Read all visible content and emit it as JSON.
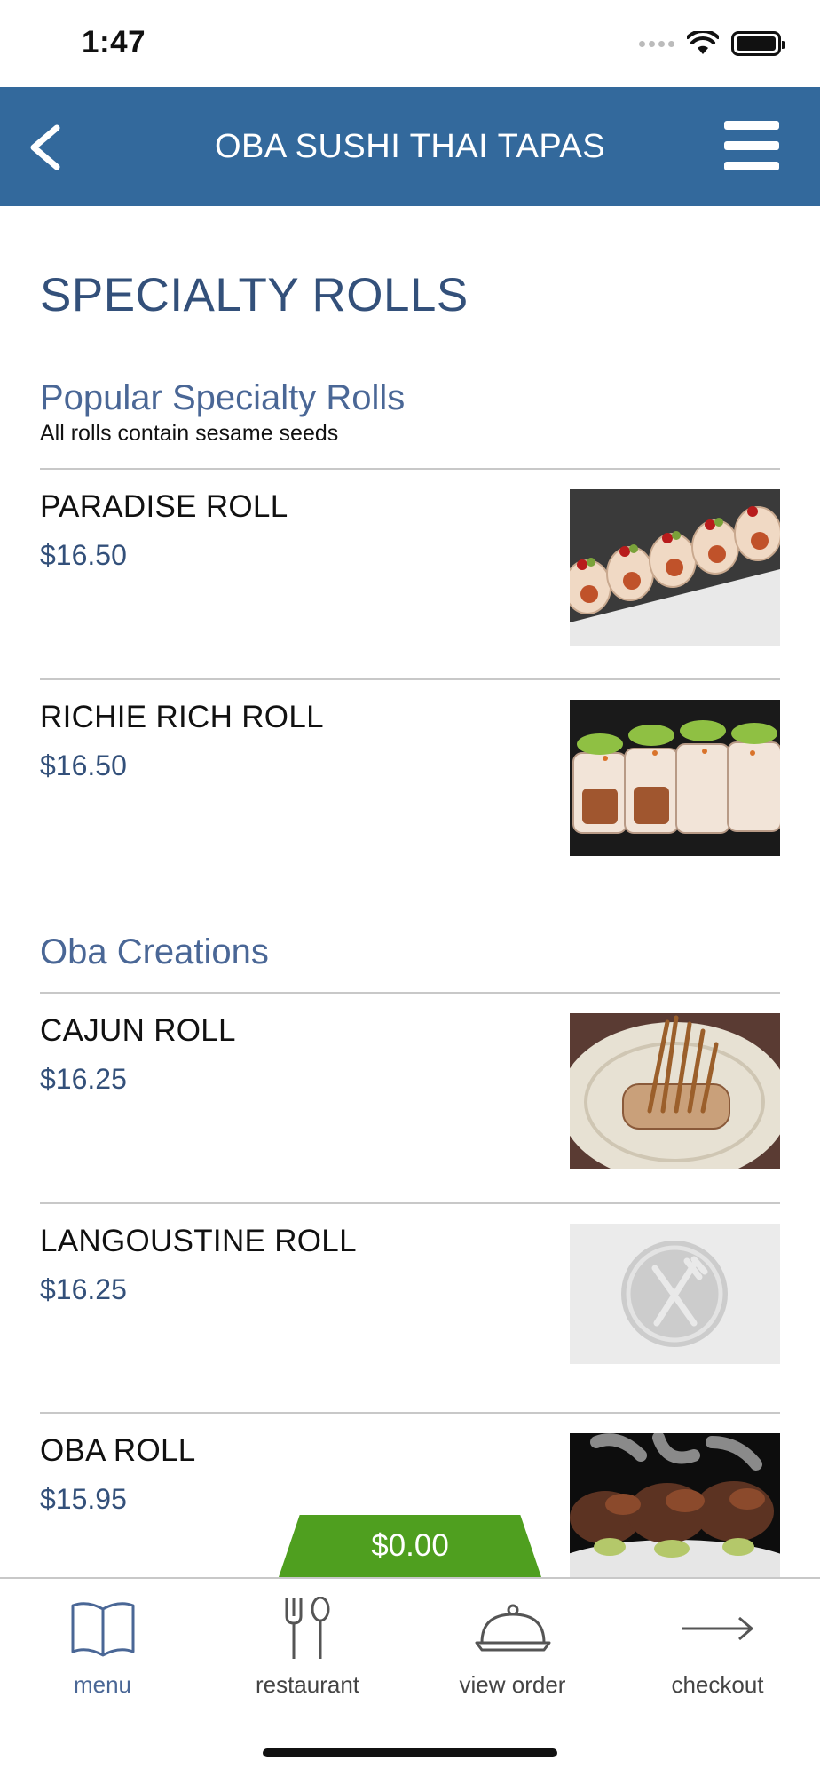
{
  "status_bar": {
    "time": "1:47"
  },
  "header": {
    "title": "OBA SUSHI THAI TAPAS"
  },
  "section": {
    "title": "SPECIALTY ROLLS"
  },
  "groups": [
    {
      "title": "Popular Specialty Rolls",
      "note": "All rolls contain sesame seeds",
      "items": [
        {
          "name": "PARADISE ROLL",
          "price": "$16.50"
        },
        {
          "name": "RICHIE RICH ROLL",
          "price": "$16.50"
        }
      ]
    },
    {
      "title": "Oba Creations",
      "items": [
        {
          "name": "CAJUN ROLL",
          "price": "$16.25"
        },
        {
          "name": "LANGOUSTINE ROLL",
          "price": "$16.25"
        },
        {
          "name": "OBA ROLL",
          "price": "$15.95"
        }
      ]
    }
  ],
  "cart": {
    "total": "$0.00"
  },
  "bottom_nav": {
    "items": [
      {
        "label": "menu",
        "icon": "book-icon",
        "active": true
      },
      {
        "label": "restaurant",
        "icon": "fork-spoon-icon",
        "active": false
      },
      {
        "label": "view order",
        "icon": "cloche-icon",
        "active": false
      },
      {
        "label": "checkout",
        "icon": "arrow-right-icon",
        "active": false
      }
    ]
  },
  "colors": {
    "header_bg": "#33699c",
    "accent_text": "#33507a",
    "cart_green": "#4f9f1f"
  }
}
